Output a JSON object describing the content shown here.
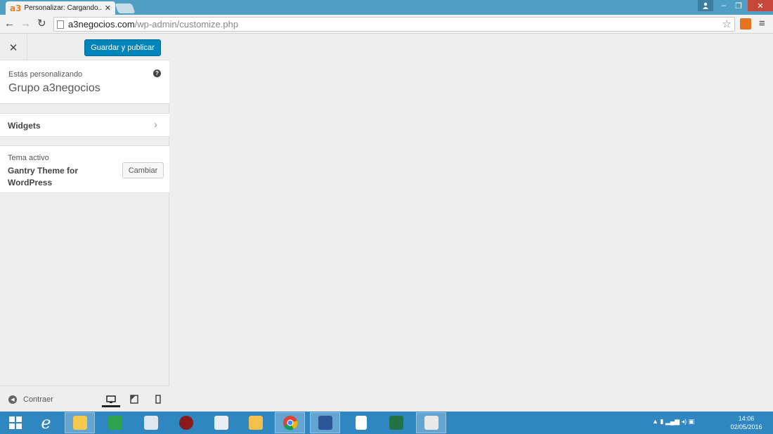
{
  "browser": {
    "tab_title": "Personalizar: Cargando...",
    "tab_logo": "a3",
    "url_host": "a3negocios.com",
    "url_path": "/wp-admin/customize.php"
  },
  "customizer": {
    "publish_label": "Guardar y publicar",
    "info_label": "Estás personalizando",
    "site_title": "Grupo a3negocios",
    "widgets_label": "Widgets",
    "theme_label": "Tema activo",
    "theme_name": "Gantry Theme for WordPress",
    "change_label": "Cambiar",
    "collapse_label": "Contraer"
  },
  "taskbar": {
    "time": "14:06",
    "date": "02/05/2016"
  },
  "colors": {
    "accent": "#0085ba",
    "chrome_bar": "#4f9ec4",
    "taskbar": "#2f86c0"
  }
}
